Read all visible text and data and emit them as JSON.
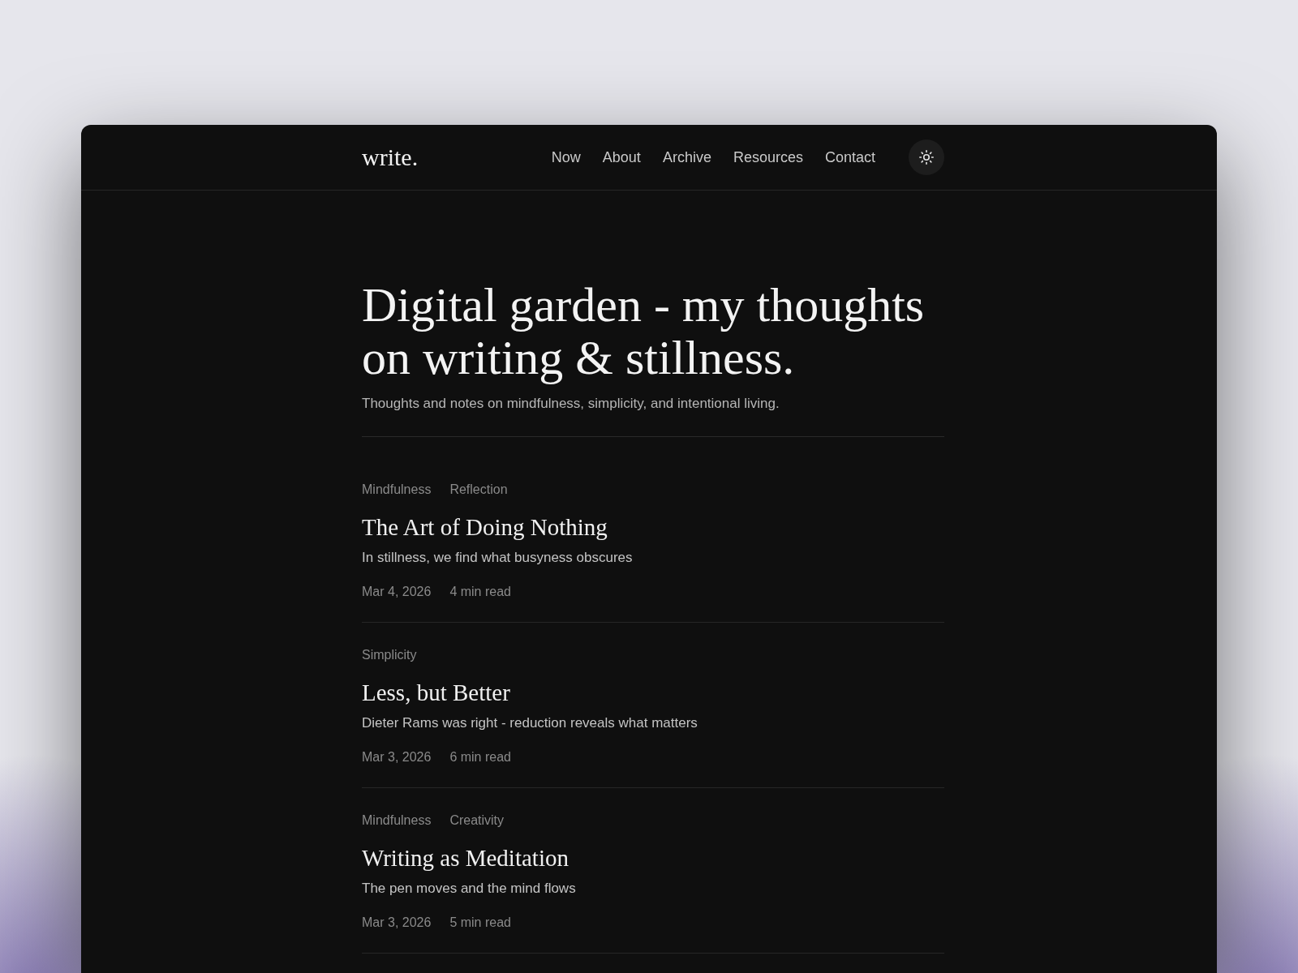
{
  "header": {
    "logo": "write.",
    "nav": [
      "Now",
      "About",
      "Archive",
      "Resources",
      "Contact"
    ]
  },
  "hero": {
    "title": "Digital garden - my thoughts on writing & stillness.",
    "subtitle": "Thoughts and notes on mindfulness, simplicity, and intentional living."
  },
  "posts": [
    {
      "tags": [
        "Mindfulness",
        "Reflection"
      ],
      "title": "The Art of Doing Nothing",
      "excerpt": "In stillness, we find what busyness obscures",
      "date": "Mar 4, 2026",
      "read_time": "4 min read"
    },
    {
      "tags": [
        "Simplicity"
      ],
      "title": "Less, but Better",
      "excerpt": "Dieter Rams was right - reduction reveals what matters",
      "date": "Mar 3, 2026",
      "read_time": "6 min read"
    },
    {
      "tags": [
        "Mindfulness",
        "Creativity"
      ],
      "title": "Writing as Meditation",
      "excerpt": "The pen moves and the mind flows",
      "date": "Mar 3, 2026",
      "read_time": "5 min read"
    }
  ]
}
